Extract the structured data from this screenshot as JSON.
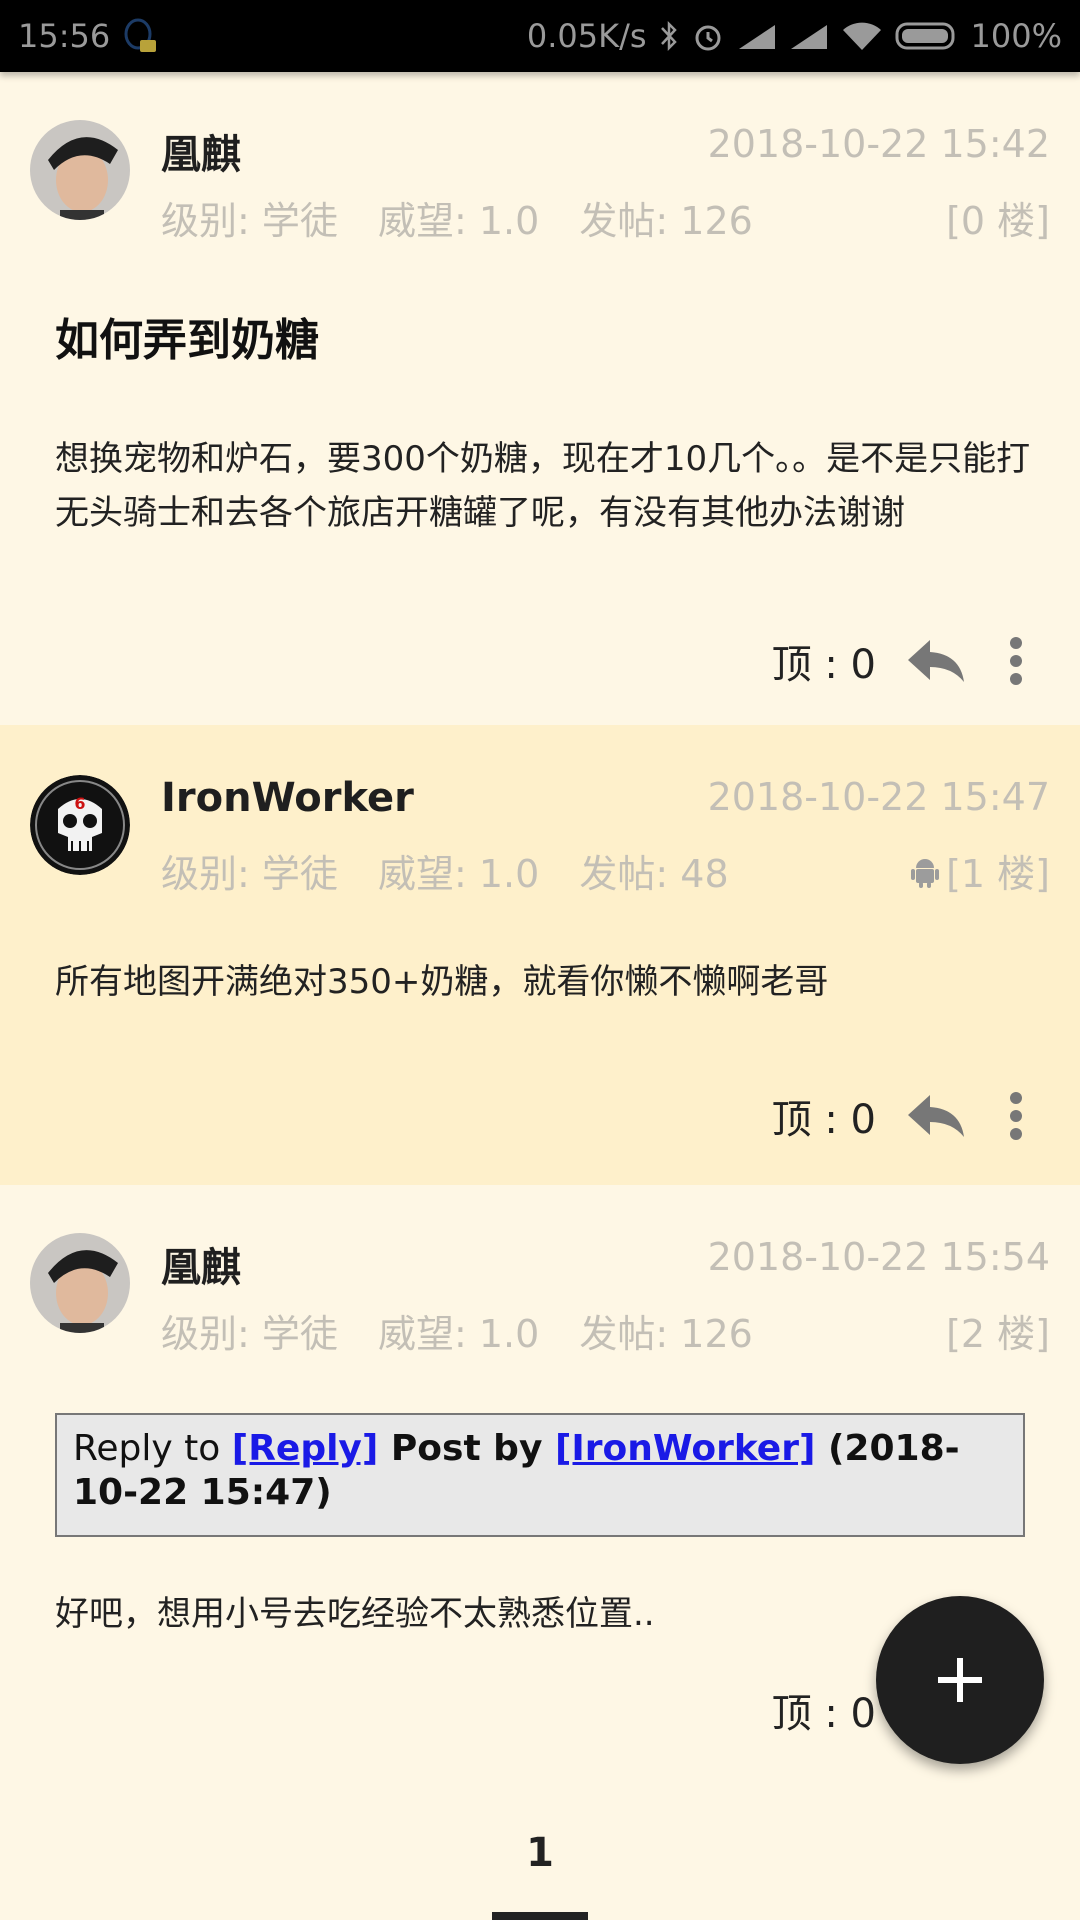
{
  "status_bar": {
    "time": "15:56",
    "net_speed": "0.05K/s",
    "battery": "100%"
  },
  "posts": [
    {
      "author": "凰麒",
      "time": "2018-10-22 15:42",
      "level": "级别: 学徒",
      "prestige": "威望: 1.0",
      "post_count": "发帖: 126",
      "floor": "[0 楼]",
      "title": "如何弄到奶糖",
      "content": "想换宠物和炉石，要300个奶糖，现在才10几个。。是不是只能打无头骑士和去各个旅店开糖罐了呢，有没有其他办法谢谢",
      "vote": "顶 : 0"
    },
    {
      "author": "IronWorker",
      "time": "2018-10-22 15:47",
      "level": "级别: 学徒",
      "prestige": "威望: 1.0",
      "post_count": "发帖: 48",
      "floor": "[1 楼]",
      "content": "所有地图开满绝对350+奶糖，就看你懒不懒啊老哥",
      "vote": "顶 : 0"
    },
    {
      "author": "凰麒",
      "time": "2018-10-22 15:54",
      "level": "级别: 学徒",
      "prestige": "威望: 1.0",
      "post_count": "发帖: 126",
      "floor": "[2 楼]",
      "quote": {
        "prefix": "Reply to ",
        "reply_link": "[Reply]",
        "post_by": " Post by ",
        "user_link": "[IronWorker]",
        "date": " (2018-10-22 15:47)"
      },
      "content": "好吧，想用小号去吃经验不太熟悉位置..",
      "vote": "顶 : 0"
    }
  ],
  "pagination": {
    "current_page": "1"
  },
  "colors": {
    "background": "#FEF7E5",
    "alt_background": "#FEF0CB",
    "link": "#1a1ae6",
    "fab": "#1f1f1f"
  }
}
